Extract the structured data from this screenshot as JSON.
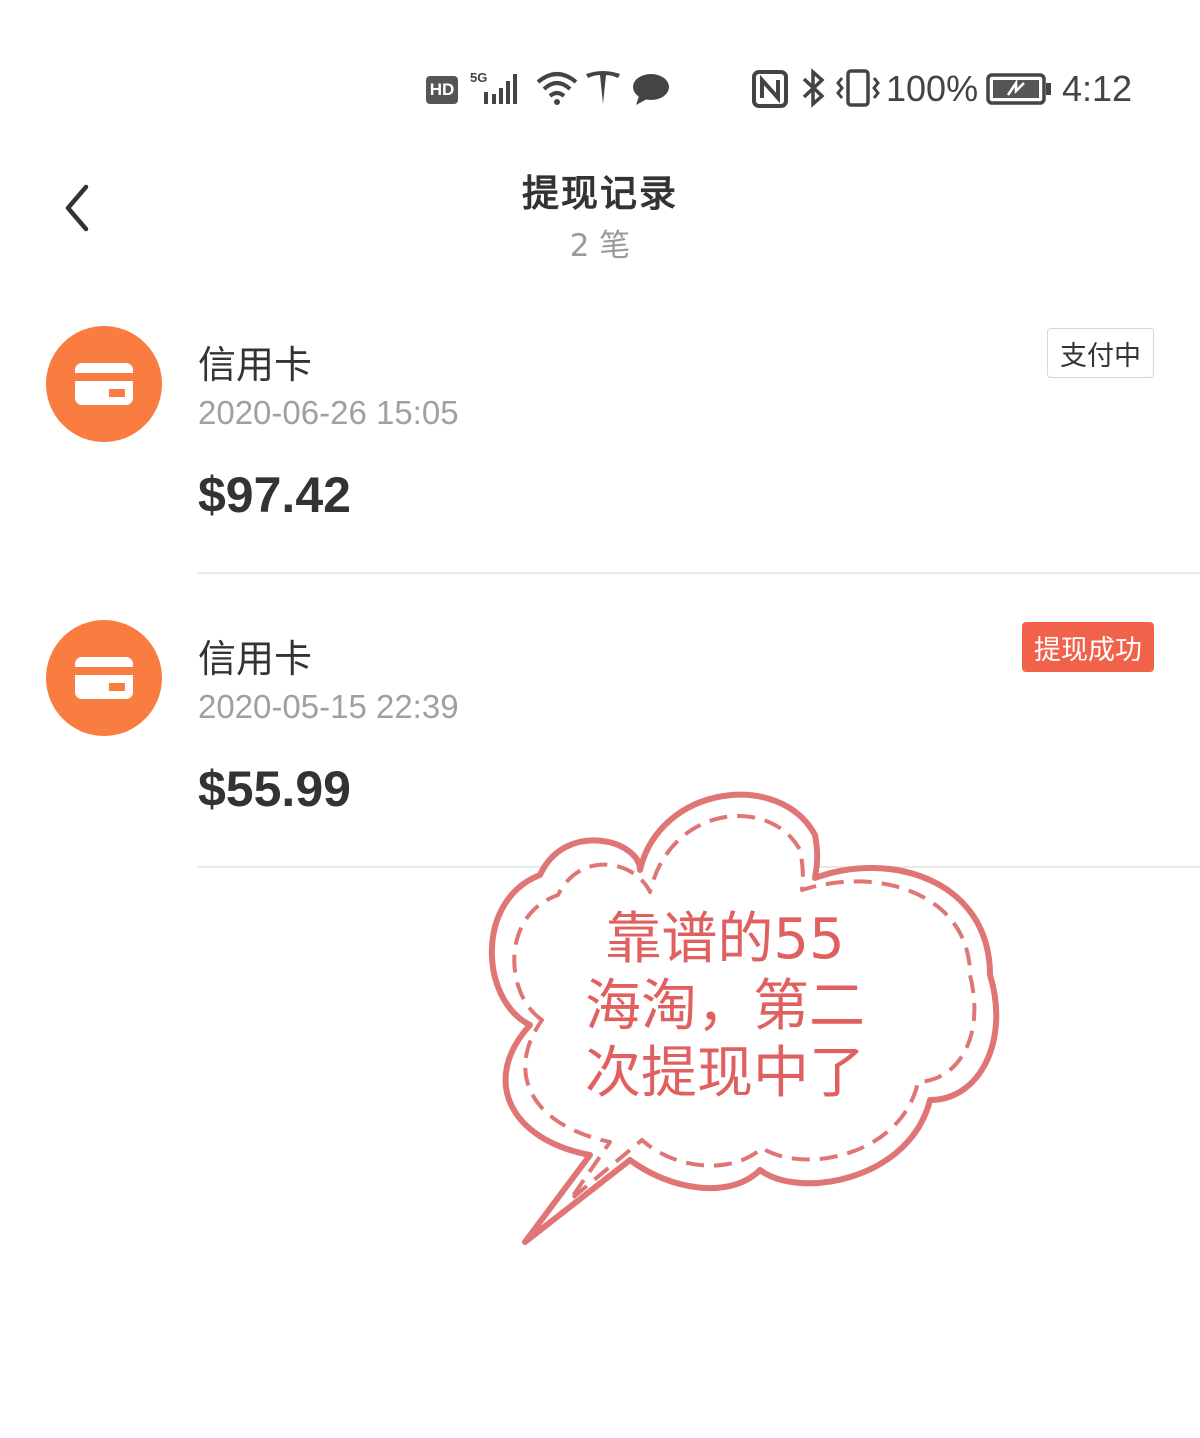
{
  "status_bar": {
    "icons": [
      "hd-icon",
      "signal-5g-icon",
      "wifi-icon",
      "tesla-icon",
      "message-icon",
      "nfc-icon",
      "bluetooth-icon",
      "vibrate-icon",
      "battery-charging-icon"
    ],
    "hd_label": "HD",
    "network_label": "5G",
    "battery_percent": "100%",
    "time": "4:12"
  },
  "header": {
    "title": "提现记录",
    "subtitle": "2 笔",
    "back_icon": "chevron-left-icon"
  },
  "records": [
    {
      "method": "信用卡",
      "time": "2020-06-26 15:05",
      "amount": "$97.42",
      "status": "支付中",
      "status_type": "pending",
      "icon": "credit-card-icon"
    },
    {
      "method": "信用卡",
      "time": "2020-05-15 22:39",
      "amount": "$55.99",
      "status": "提现成功",
      "status_type": "success",
      "icon": "credit-card-icon"
    }
  ],
  "overlay": {
    "lines": [
      "靠谱的55",
      "海淘，第二",
      "次提现中了"
    ]
  },
  "colors": {
    "accent_orange": "#f97d41",
    "success_badge": "#f06249",
    "overlay_stroke": "#e07575",
    "overlay_text": "#e0605f",
    "muted_text": "#a0a0a0",
    "primary_text": "#333333"
  }
}
